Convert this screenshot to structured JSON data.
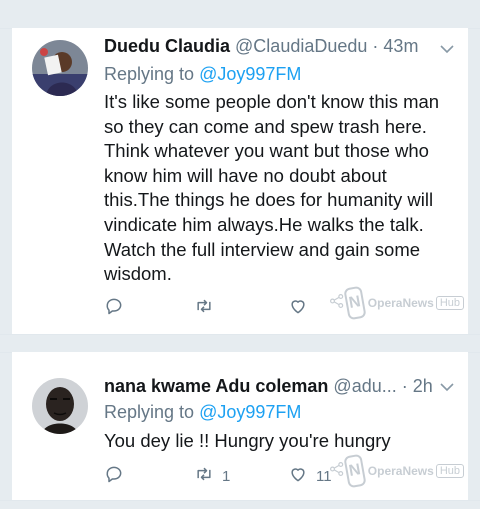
{
  "tweets": [
    {
      "name": "Duedu Claudia",
      "handle": "@ClaudiaDuedu",
      "dot": "·",
      "time": "43m",
      "replying_prefix": "Replying to",
      "replying_to": "@Joy997FM",
      "text": "It's like some people don't know this man so they can come and spew trash here. Think whatever you want but those who know him will have no doubt about this.The things he does for humanity will vindicate him always.He walks the talk. Watch the full interview and gain some wisdom.",
      "retweets": "",
      "likes": "",
      "watermark": {
        "logo": "N",
        "text": "OperaNews",
        "hub": "Hub"
      }
    },
    {
      "name": "nana kwame Adu coleman",
      "handle": "@adu...",
      "dot": "·",
      "time": "2h",
      "replying_prefix": "Replying to",
      "replying_to": "@Joy997FM",
      "text": "You dey lie !! Hungry you're hungry",
      "retweets": "1",
      "likes": "11",
      "watermark": {
        "logo": "N",
        "text": "OperaNews",
        "hub": "Hub"
      }
    }
  ],
  "icons": {
    "reply": "reply-icon",
    "retweet": "retweet-icon",
    "like": "heart-icon",
    "share": "share-icon",
    "menu": "chevron-down-icon"
  },
  "colors": {
    "link": "#1da1f2",
    "muted": "#657786",
    "text": "#14171a",
    "background": "#e6ecf0"
  }
}
